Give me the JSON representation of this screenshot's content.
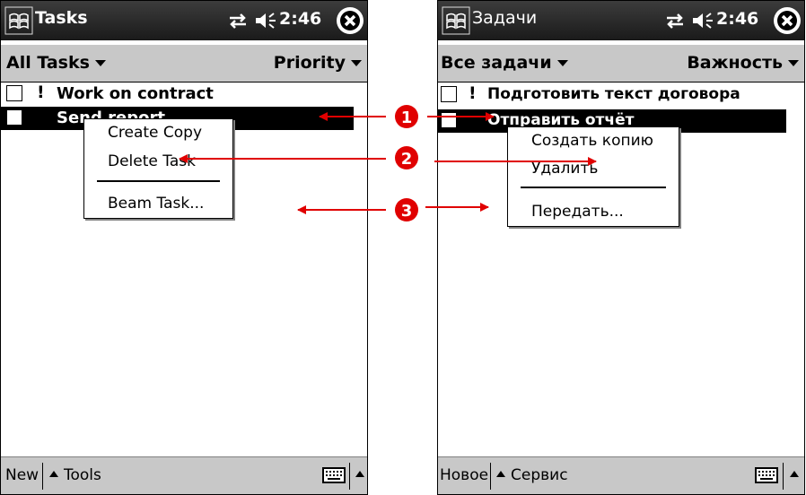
{
  "left": {
    "app_title": "Tasks",
    "clock": "2:46",
    "filter": "All Tasks",
    "sort": "Priority",
    "tasks": [
      {
        "priority_mark": "!",
        "label": "Work on contract",
        "selected": false
      },
      {
        "priority_mark": "",
        "label": "Send report",
        "selected": true
      }
    ],
    "context_menu": [
      "Create Copy",
      "Delete Task",
      "Beam Task..."
    ],
    "bottom": {
      "new_label": "New",
      "tools_label": "Tools"
    }
  },
  "right": {
    "app_title": "Задачи",
    "clock": "2:46",
    "filter": "Все задачи",
    "sort": "Важность",
    "tasks": [
      {
        "priority_mark": "!",
        "label": "Подготовить текст договора",
        "selected": false
      },
      {
        "priority_mark": "",
        "label": "Отправить отчёт",
        "selected": true
      }
    ],
    "context_menu": [
      "Создать копию",
      "Удалить",
      "Передать..."
    ],
    "bottom": {
      "new_label": "Новое",
      "tools_label": "Сервис"
    }
  },
  "callouts": [
    "1",
    "2",
    "3"
  ],
  "colors": {
    "callout_red": "#e00000",
    "titlebar": "#2a2a2a",
    "bar_gray": "#c8c8c8",
    "selection": "#000000"
  }
}
